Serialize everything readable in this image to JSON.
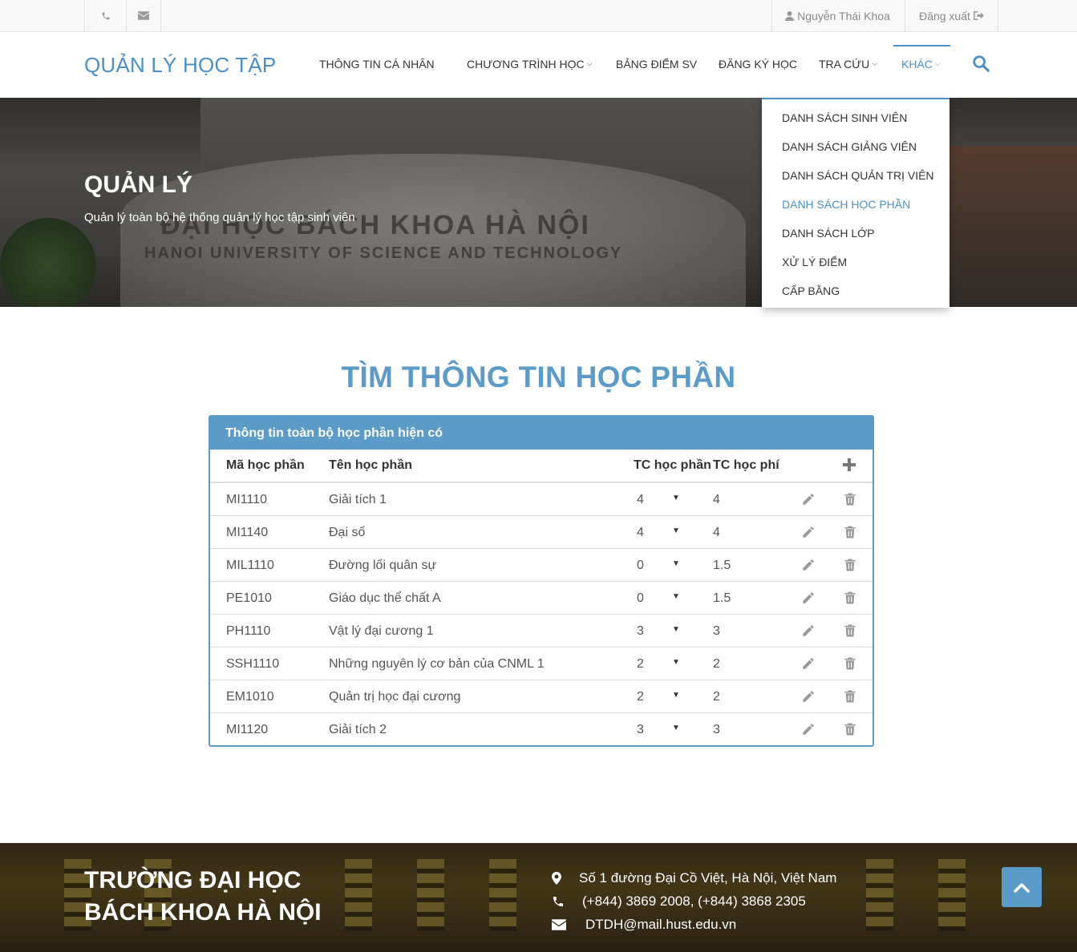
{
  "topbar": {
    "user_name": "Nguyễn Thái Khoa",
    "logout_label": "Đăng xuất"
  },
  "header": {
    "brand": "QUẢN LÝ HỌC TẬP",
    "nav": {
      "personal": "THÔNG TIN CÁ NHÂN",
      "program": "CHƯƠNG TRÌNH HỌC",
      "grades": "BẢNG ĐIỂM SV",
      "register": "ĐĂNG KÝ HỌC",
      "lookup": "TRA CỨU",
      "other": "KHÁC"
    }
  },
  "dropdown": {
    "items": [
      "DANH SÁCH SINH VIÊN",
      "DANH SÁCH GIẢNG VIÊN",
      "DANH SÁCH QUẢN TRỊ VIÊN",
      "DANH SÁCH HỌC PHẦN",
      "DANH SÁCH LỚP",
      "XỬ LÝ ĐIỂM",
      "CẤP BẰNG"
    ],
    "active_index": 3
  },
  "hero": {
    "title": "QUẢN LÝ",
    "subtitle": "Quản lý toàn bộ hệ thống quản lý học tập sinh viên",
    "stone_line1": "ĐẠI HỌC BÁCH KHOA HÀ NỘI",
    "stone_line2": "HANOI UNIVERSITY OF SCIENCE AND TECHNOLOGY"
  },
  "main": {
    "title": "TÌM THÔNG TIN HỌC PHẦN",
    "panel_title": "Thông tin toàn bộ học phần hiện có",
    "columns": {
      "code": "Mã học phần",
      "name": "Tên học phần",
      "tc": "TC học phần",
      "fee": "TC học phí"
    },
    "rows": [
      {
        "code": "MI1110",
        "name": "Giải tích 1",
        "tc": "4",
        "fee": "4"
      },
      {
        "code": "MI1140",
        "name": "Đại số",
        "tc": "4",
        "fee": "4"
      },
      {
        "code": "MIL1110",
        "name": "Đường lối quân sự",
        "tc": "0",
        "fee": "1.5"
      },
      {
        "code": "PE1010",
        "name": "Giáo dục thể chất A",
        "tc": "0",
        "fee": "1.5"
      },
      {
        "code": "PH1110",
        "name": "Vật lý đại cương 1",
        "tc": "3",
        "fee": "3"
      },
      {
        "code": "SSH1110",
        "name": "Những nguyên lý cơ bản của CNML 1",
        "tc": "2",
        "fee": "2"
      },
      {
        "code": "EM1010",
        "name": "Quản trị học đại cương",
        "tc": "2",
        "fee": "2"
      },
      {
        "code": "MI1120",
        "name": "Giải tích 2",
        "tc": "3",
        "fee": "3"
      }
    ]
  },
  "footer": {
    "title_line1": "TRƯỜNG ĐẠI HỌC",
    "title_line2": "BÁCH KHOA HÀ NỘI",
    "address": "Số 1 đường Đại Cồ Việt, Hà Nội, Việt Nam",
    "phone": "(+844) 3869 2008, (+844) 3868 2305",
    "email": "DTDH@mail.hust.edu.vn"
  },
  "colors": {
    "accent": "#5b9bc8",
    "brand": "#4a90c4"
  }
}
